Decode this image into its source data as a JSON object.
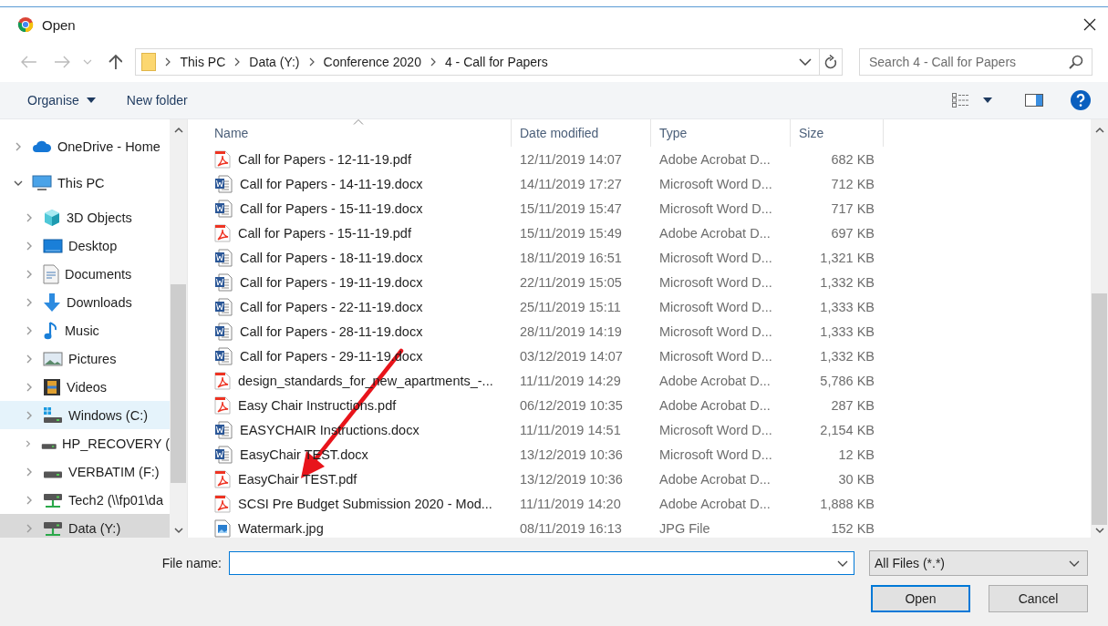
{
  "window": {
    "title": "Open"
  },
  "nav": {
    "path": [
      "This PC",
      "Data (Y:)",
      "Conference 2020",
      "4 - Call for Papers"
    ],
    "search": {
      "placeholder": "Search 4 - Call for Papers"
    }
  },
  "toolbar": {
    "organise": "Organise",
    "new_folder": "New folder"
  },
  "sidebar": {
    "items": [
      {
        "label": "OneDrive - Home",
        "kind": "cloud",
        "expanded": false,
        "selected": false,
        "hovered": false
      },
      {
        "label": "This PC",
        "kind": "pc",
        "expanded": true,
        "selected": false,
        "hovered": false,
        "children": [
          {
            "label": "3D Objects",
            "kind": "cube",
            "expanded": false,
            "selected": false,
            "hovered": false
          },
          {
            "label": "Desktop",
            "kind": "desktop",
            "expanded": false,
            "selected": false,
            "hovered": false
          },
          {
            "label": "Documents",
            "kind": "documents",
            "expanded": false,
            "selected": false,
            "hovered": false
          },
          {
            "label": "Downloads",
            "kind": "downloads",
            "expanded": false,
            "selected": false,
            "hovered": false
          },
          {
            "label": "Music",
            "kind": "music",
            "expanded": false,
            "selected": false,
            "hovered": false
          },
          {
            "label": "Pictures",
            "kind": "pictures",
            "expanded": false,
            "selected": false,
            "hovered": false
          },
          {
            "label": "Videos",
            "kind": "videos",
            "expanded": false,
            "selected": false,
            "hovered": false
          },
          {
            "label": "Windows  (C:)",
            "kind": "system-drive",
            "expanded": false,
            "selected": false,
            "hovered": true
          },
          {
            "label": "HP_RECOVERY (",
            "kind": "drive",
            "expanded": false,
            "selected": false,
            "hovered": false
          },
          {
            "label": "VERBATIM (F:)",
            "kind": "drive",
            "expanded": false,
            "selected": false,
            "hovered": false
          },
          {
            "label": "Tech2 (\\\\fp01\\da",
            "kind": "network-drive",
            "expanded": false,
            "selected": false,
            "hovered": false
          },
          {
            "label": "Data (Y:)",
            "kind": "network-drive",
            "expanded": false,
            "selected": true,
            "hovered": false
          }
        ]
      }
    ]
  },
  "table": {
    "columns": [
      {
        "label": "Name",
        "sorted": true
      },
      {
        "label": "Date modified",
        "sorted": false
      },
      {
        "label": "Type",
        "sorted": false
      },
      {
        "label": "Size",
        "sorted": false
      }
    ],
    "rows": [
      {
        "kind": "pdf",
        "name": "Call for Papers - 12-11-19.pdf",
        "date": "12/11/2019 14:07",
        "type": "Adobe Acrobat D...",
        "size": "682 KB"
      },
      {
        "kind": "word",
        "name": "Call for Papers - 14-11-19.docx",
        "date": "14/11/2019 17:27",
        "type": "Microsoft Word D...",
        "size": "712 KB"
      },
      {
        "kind": "word",
        "name": "Call for Papers - 15-11-19.docx",
        "date": "15/11/2019 15:47",
        "type": "Microsoft Word D...",
        "size": "717 KB"
      },
      {
        "kind": "pdf",
        "name": "Call for Papers - 15-11-19.pdf",
        "date": "15/11/2019 15:49",
        "type": "Adobe Acrobat D...",
        "size": "697 KB"
      },
      {
        "kind": "word",
        "name": "Call for Papers - 18-11-19.docx",
        "date": "18/11/2019 16:51",
        "type": "Microsoft Word D...",
        "size": "1,321 KB"
      },
      {
        "kind": "word",
        "name": "Call for Papers - 19-11-19.docx",
        "date": "22/11/2019 15:05",
        "type": "Microsoft Word D...",
        "size": "1,332 KB"
      },
      {
        "kind": "word",
        "name": "Call for Papers - 22-11-19.docx",
        "date": "25/11/2019 15:11",
        "type": "Microsoft Word D...",
        "size": "1,333 KB"
      },
      {
        "kind": "word",
        "name": "Call for Papers - 28-11-19.docx",
        "date": "28/11/2019 14:19",
        "type": "Microsoft Word D...",
        "size": "1,333 KB"
      },
      {
        "kind": "word",
        "name": "Call for Papers - 29-11-19.docx",
        "date": "03/12/2019 14:07",
        "type": "Microsoft Word D...",
        "size": "1,332 KB"
      },
      {
        "kind": "pdf",
        "name": "design_standards_for_new_apartments_-...",
        "date": "11/11/2019 14:29",
        "type": "Adobe Acrobat D...",
        "size": "5,786 KB"
      },
      {
        "kind": "pdf",
        "name": "Easy Chair Instructions.pdf",
        "date": "06/12/2019 10:35",
        "type": "Adobe Acrobat D...",
        "size": "287 KB"
      },
      {
        "kind": "word",
        "name": "EASYCHAIR Instructions.docx",
        "date": "11/11/2019 14:51",
        "type": "Microsoft Word D...",
        "size": "2,154 KB"
      },
      {
        "kind": "word",
        "name": "EasyChair TEST.docx",
        "date": "13/12/2019 10:36",
        "type": "Microsoft Word D...",
        "size": "12 KB"
      },
      {
        "kind": "pdf",
        "name": "EasyChair TEST.pdf",
        "date": "13/12/2019 10:36",
        "type": "Adobe Acrobat D...",
        "size": "30 KB"
      },
      {
        "kind": "pdf",
        "name": "SCSI Pre Budget Submission 2020 - Mod...",
        "date": "11/11/2019 14:20",
        "type": "Adobe Acrobat D...",
        "size": "1,888 KB"
      },
      {
        "kind": "image",
        "name": "Watermark.jpg",
        "date": "08/11/2019 16:13",
        "type": "JPG File",
        "size": "152 KB"
      }
    ]
  },
  "footer": {
    "file_name_label": "File name:",
    "filter": "All Files (*.*)",
    "buttons": [
      {
        "label": "Open",
        "default": true
      },
      {
        "label": "Cancel",
        "default": false
      }
    ]
  }
}
